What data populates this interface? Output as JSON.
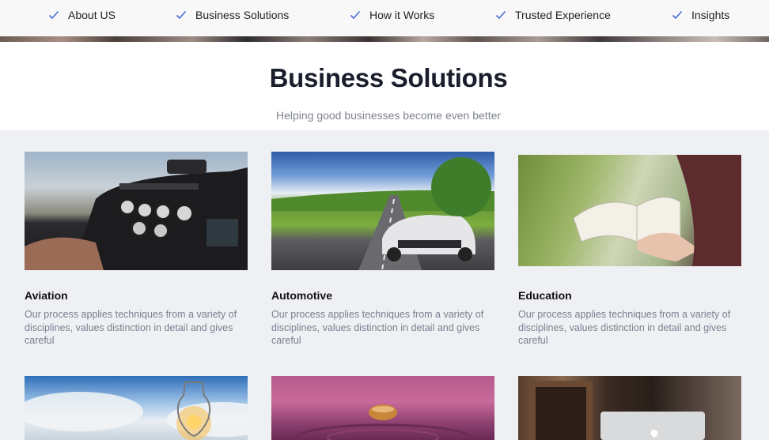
{
  "nav": {
    "items": [
      {
        "label": "About US",
        "icon": "check-icon"
      },
      {
        "label": "Business Solutions",
        "icon": "check-icon"
      },
      {
        "label": "How it Works",
        "icon": "check-icon"
      },
      {
        "label": "Trusted Experience",
        "icon": "check-icon"
      },
      {
        "label": "Insights",
        "icon": "check-icon"
      }
    ],
    "accent": "#4a6cd4"
  },
  "section": {
    "title": "Business Solutions",
    "subtitle": "Helping good businesses become even better"
  },
  "cards": [
    {
      "title": "Aviation",
      "description": "Our process applies techniques from a variety of disciplines, values distinction in detail and gives careful"
    },
    {
      "title": "Automotive",
      "description": "Our process applies techniques from a variety of disciplines, values distinction in detail and gives careful"
    },
    {
      "title": "Education",
      "description": "Our process applies techniques from a variety of disciplines, values distinction in detail and gives careful"
    }
  ],
  "colors": {
    "heading": "#1a1d2b",
    "muted": "#7c8090",
    "content_bg": "#eef0f3"
  }
}
